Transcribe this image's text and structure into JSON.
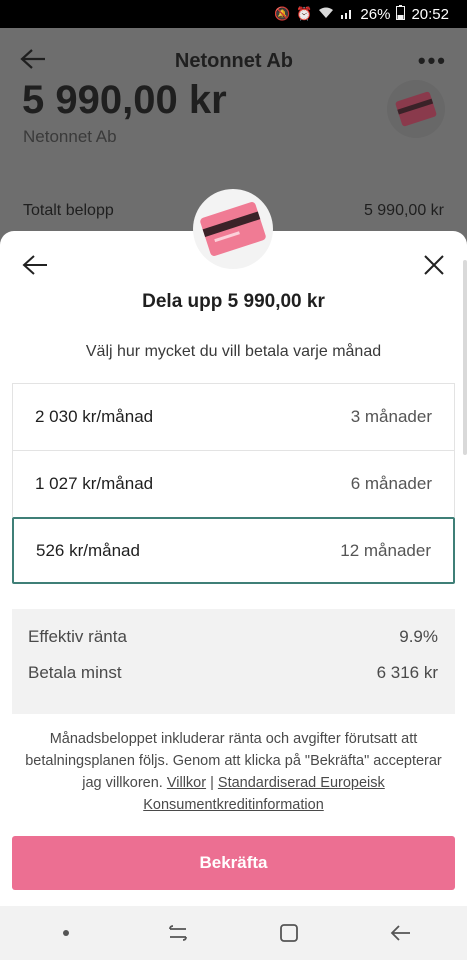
{
  "status_bar": {
    "battery": "26%",
    "time": "20:52",
    "icons": [
      "mute-icon",
      "alarm-icon",
      "wifi-icon",
      "signal-icon",
      "battery-icon"
    ]
  },
  "background_page": {
    "title": "Netonnet Ab",
    "amount": "5 990,00 kr",
    "merchant": "Netonnet Ab",
    "total_label": "Totalt belopp",
    "total_value": "5 990,00 kr"
  },
  "sheet": {
    "title": "Dela upp 5 990,00 kr",
    "subtitle": "Välj hur mycket du vill betala varje månad",
    "options": [
      {
        "amount": "2 030 kr/månad",
        "months": "3 månader",
        "selected": false
      },
      {
        "amount": "1 027 kr/månad",
        "months": "6 månader",
        "selected": false
      },
      {
        "amount": "526 kr/månad",
        "months": "12 månader",
        "selected": true
      }
    ],
    "summary": {
      "rate_label": "Effektiv ränta",
      "rate_value": "9.9%",
      "min_label": "Betala minst",
      "min_value": "6 316 kr"
    },
    "disclaimer": {
      "text": "Månadsbeloppet inkluderar ränta och avgifter förutsatt att betalningsplanen följs. Genom att klicka på \"Bekräfta\" accepterar jag villkoren.",
      "link_terms": "Villkor",
      "separator": "|",
      "link_info": "Standardiserad Europeisk Konsumentkreditinformation"
    },
    "confirm_label": "Bekräfta"
  },
  "colors": {
    "accent_pink": "#ec6f92",
    "selected_border": "#3f7f77"
  }
}
